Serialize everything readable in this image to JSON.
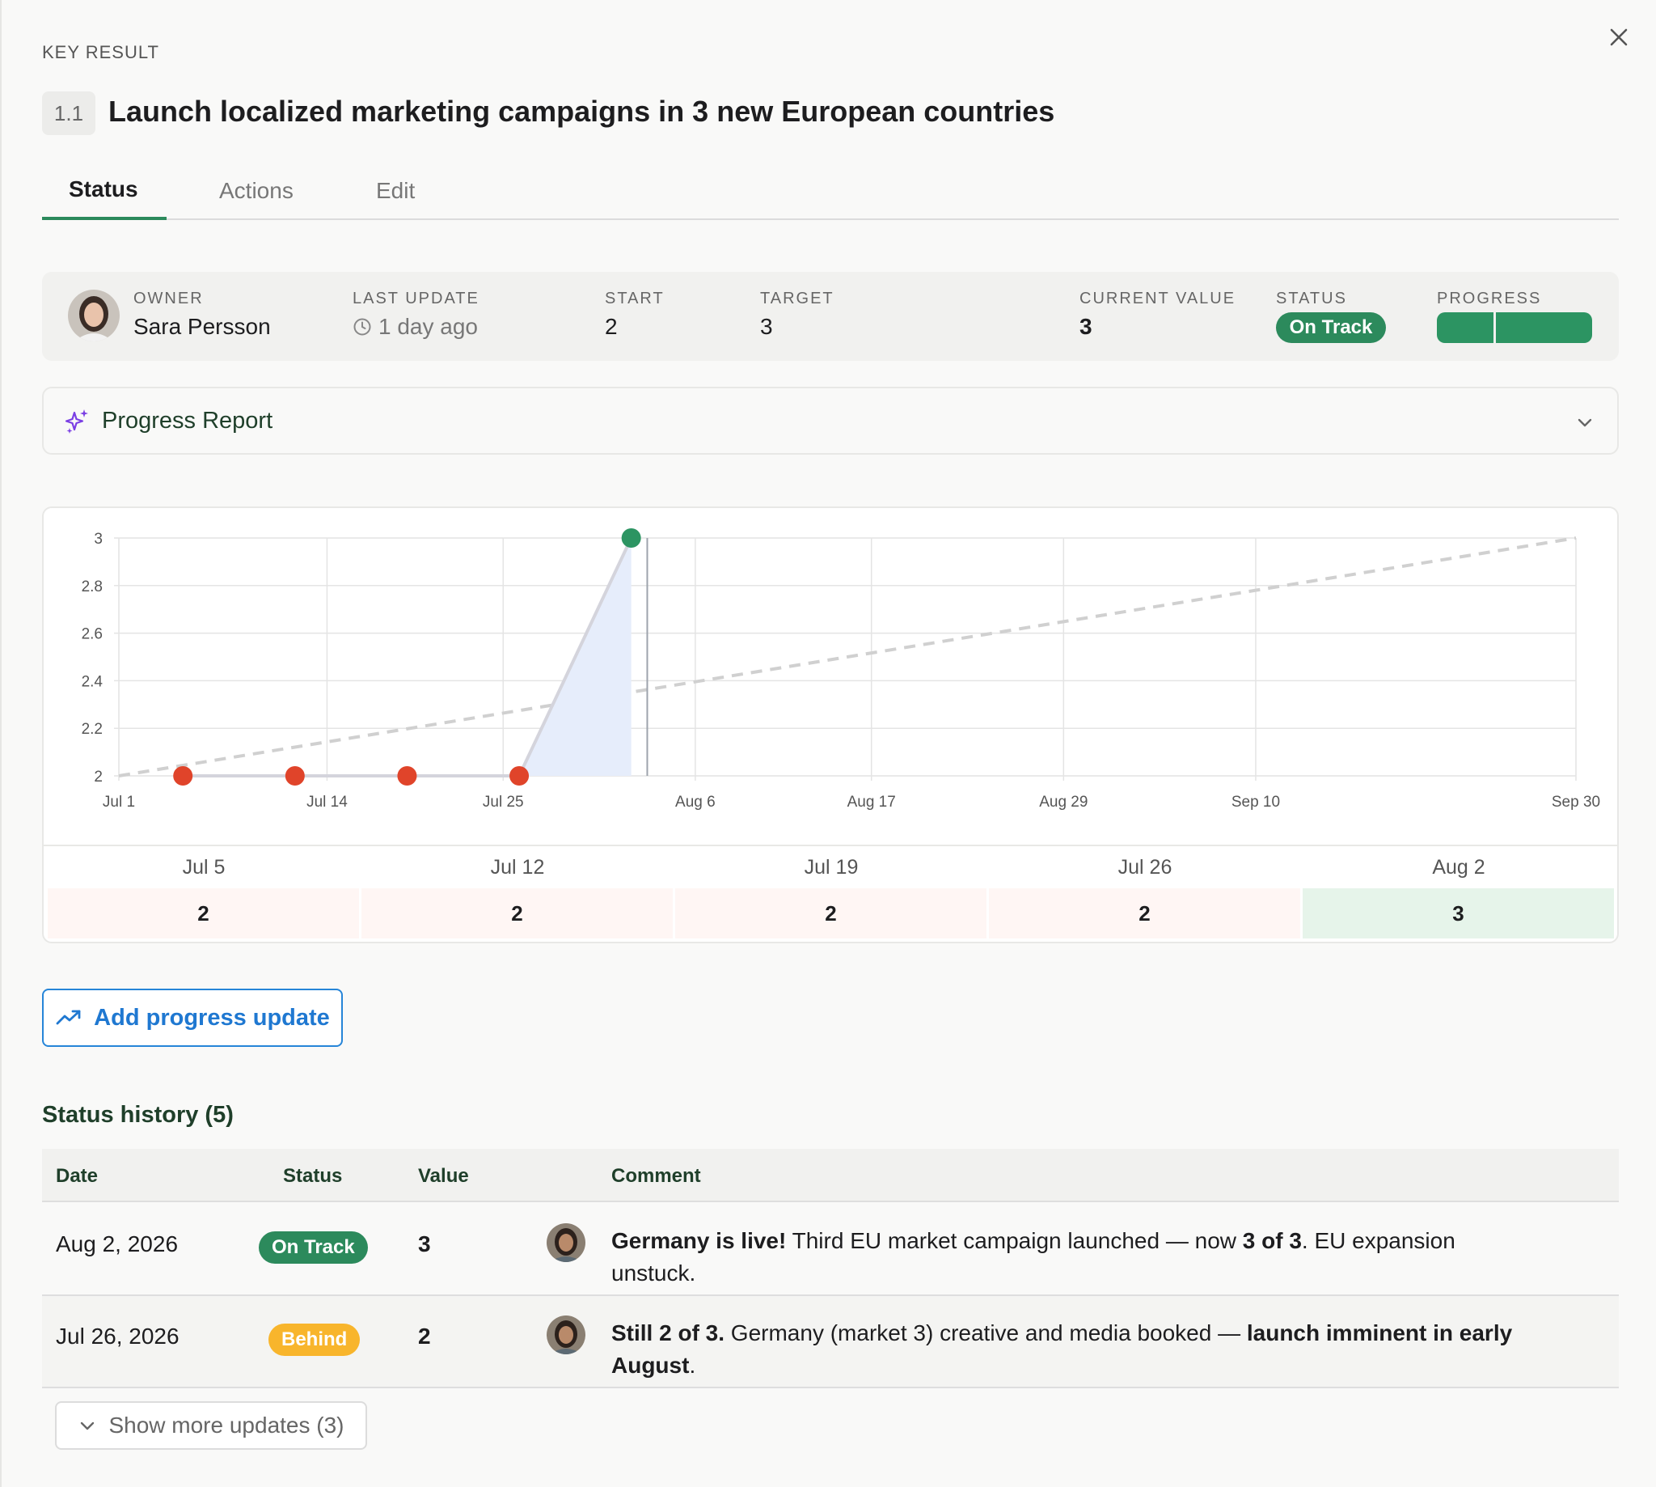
{
  "header": {
    "eyebrow": "KEY RESULT",
    "kr_id": "1.1",
    "title": "Launch localized marketing campaigns in 3 new European countries"
  },
  "tabs": [
    {
      "label": "Status",
      "active": true
    },
    {
      "label": "Actions",
      "active": false
    },
    {
      "label": "Edit",
      "active": false
    }
  ],
  "summary": {
    "owner_label": "OWNER",
    "owner_name": "Sara Persson",
    "last_update_label": "LAST UPDATE",
    "last_update_value": "1 day ago",
    "start_label": "START",
    "start_value": "2",
    "target_label": "TARGET",
    "target_value": "3",
    "current_label": "CURRENT VALUE",
    "current_value": "3",
    "status_label": "STATUS",
    "status_value": "On Track",
    "progress_label": "PROGRESS",
    "progress_fraction": 1.0
  },
  "report": {
    "icon": "sparkles-icon",
    "title": "Progress Report"
  },
  "chart_data": {
    "type": "line",
    "y_ticks": [
      "3",
      "2.8",
      "2.6",
      "2.4",
      "2.2",
      "2"
    ],
    "ylim": [
      2,
      3
    ],
    "x_ticks": [
      "Jul 1",
      "Jul 14",
      "Jul 25",
      "Aug 6",
      "Aug 17",
      "Aug 29",
      "Sep 10",
      "Sep 30"
    ],
    "x_range": [
      "2026-07-01",
      "2026-09-30"
    ],
    "grid": true,
    "series": [
      {
        "points": [
          {
            "x": "2026-07-05",
            "y": 2,
            "status": "behind"
          },
          {
            "x": "2026-07-12",
            "y": 2,
            "status": "behind"
          },
          {
            "x": "2026-07-19",
            "y": 2,
            "status": "behind"
          },
          {
            "x": "2026-07-26",
            "y": 2,
            "status": "behind"
          },
          {
            "x": "2026-08-02",
            "y": 3,
            "status": "on-track"
          }
        ]
      }
    ],
    "target_line": [
      {
        "x": "2026-07-01",
        "y": 2
      },
      {
        "x": "2026-09-30",
        "y": 3
      }
    ],
    "today_marker": "2026-08-03",
    "colors": {
      "behind": "#e0442a",
      "on_track": "#2c9462",
      "area": "#e6edfb",
      "target": "#d0d0d0"
    }
  },
  "weekly": [
    {
      "week": "Jul 5",
      "value": "2",
      "status": "behind"
    },
    {
      "week": "Jul 12",
      "value": "2",
      "status": "behind"
    },
    {
      "week": "Jul 19",
      "value": "2",
      "status": "behind"
    },
    {
      "week": "Jul 26",
      "value": "2",
      "status": "behind"
    },
    {
      "week": "Aug 2",
      "value": "3",
      "status": "on-track"
    }
  ],
  "add_update": {
    "label": "Add progress update",
    "icon": "trending-up-icon"
  },
  "history": {
    "title": "Status history (5)",
    "columns": [
      "Date",
      "Status",
      "Value",
      "Comment"
    ],
    "rows": [
      {
        "date": "Aug 2, 2026",
        "status": "On Track",
        "status_color": "#2c8a5c",
        "value": "3",
        "comment": [
          {
            "text": "Germany is live!",
            "bold": true
          },
          {
            "text": " Third EU market campaign launched — now ",
            "bold": false
          },
          {
            "text": "3 of 3",
            "bold": true
          },
          {
            "text": ". EU expansion unstuck.",
            "bold": false
          }
        ]
      },
      {
        "date": "Jul 26, 2026",
        "status": "Behind",
        "status_color": "#f8b52c",
        "value": "2",
        "comment": [
          {
            "text": "Still 2 of 3.",
            "bold": true
          },
          {
            "text": " Germany (market 3) creative and media booked — ",
            "bold": false
          },
          {
            "text": "launch imminent in early August",
            "bold": true
          },
          {
            "text": ".",
            "bold": false
          }
        ]
      }
    ],
    "show_more_label": "Show more updates (3)"
  }
}
